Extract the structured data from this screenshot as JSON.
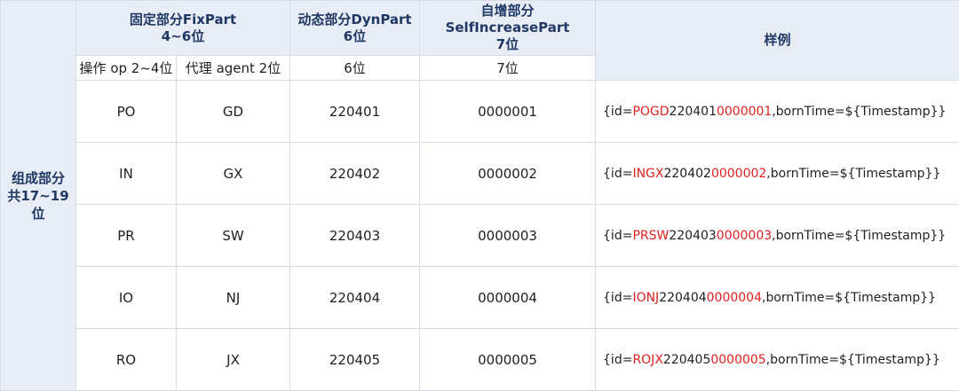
{
  "side_label": [
    "组成部分",
    "共17~19位"
  ],
  "headers": {
    "fix": [
      "固定部分FixPart",
      "4~6位"
    ],
    "dyn": [
      "动态部分DynPart",
      "6位"
    ],
    "self": [
      "自增部分SelfIncreasePart",
      "7位"
    ],
    "sample": "样例"
  },
  "subheaders": {
    "op": "操作 op 2~4位",
    "agent": "代理 agent 2位",
    "dyn": "6位",
    "self": "7位"
  },
  "rows": [
    {
      "op": "PO",
      "agent": "GD",
      "dyn": "220401",
      "self": "0000001",
      "s_pre": "{id=",
      "s_code": "POGD",
      "s_dyn": "220401",
      "s_self": "0000001",
      "s_post": ",bornTime=${Timestamp}}"
    },
    {
      "op": "IN",
      "agent": "GX",
      "dyn": "220402",
      "self": "0000002",
      "s_pre": "{id=",
      "s_code": "INGX",
      "s_dyn": "220402",
      "s_self": "0000002",
      "s_post": ",bornTime=${Timestamp}}"
    },
    {
      "op": "PR",
      "agent": "SW",
      "dyn": "220403",
      "self": "0000003",
      "s_pre": "{id=",
      "s_code": "PRSW",
      "s_dyn": "220403",
      "s_self": "0000003",
      "s_post": ",bornTime=${Timestamp}}"
    },
    {
      "op": "IO",
      "agent": "NJ",
      "dyn": "220404",
      "self": "0000004",
      "s_pre": "{id=",
      "s_code": "IONJ",
      "s_dyn": "220404",
      "s_self": "0000004",
      "s_post": ",bornTime=${Timestamp}}"
    },
    {
      "op": "RO",
      "agent": "JX",
      "dyn": "220405",
      "self": "0000005",
      "s_pre": "{id=",
      "s_code": "ROJX",
      "s_dyn": "220405",
      "s_self": "0000005",
      "s_post": ",bornTime=${Timestamp}}"
    }
  ],
  "colors": {
    "header_bg": "#e8edf5",
    "header_text": "#1f3864",
    "highlight": "#e02020",
    "border": "#d7dde8"
  }
}
